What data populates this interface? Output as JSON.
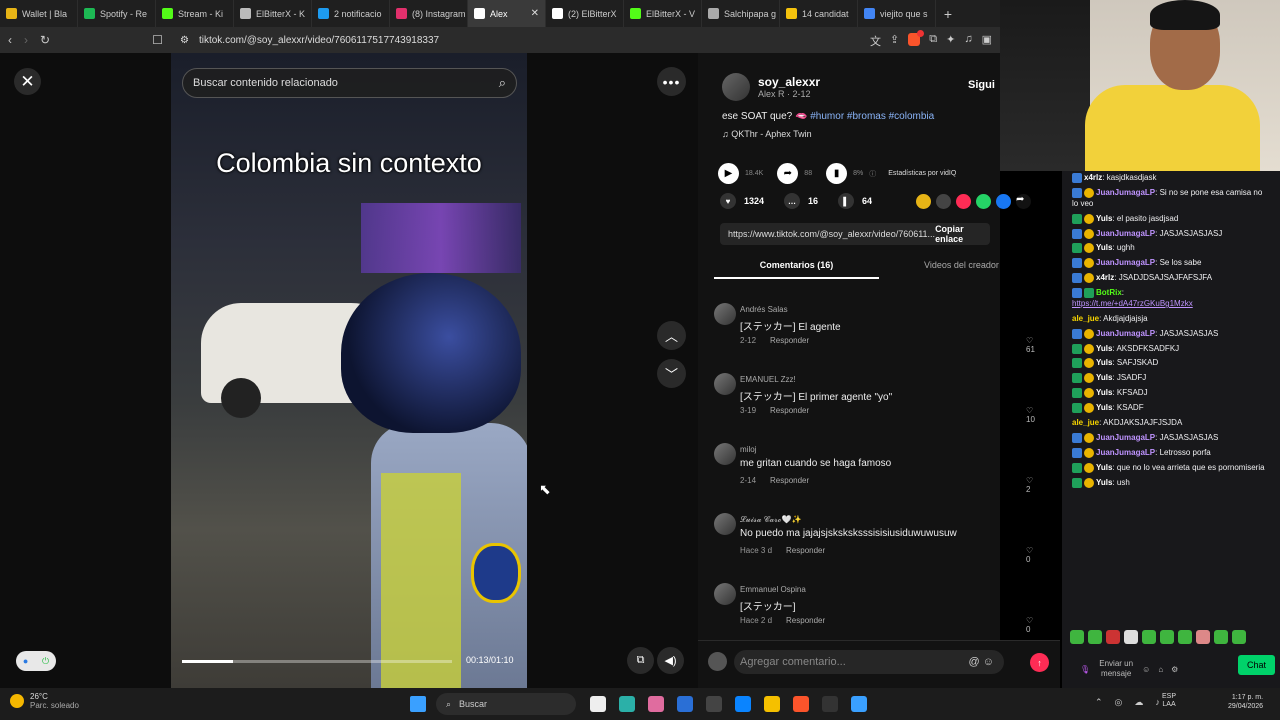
{
  "browser": {
    "tabs": [
      {
        "label": "Wallet | Bla",
        "color": "#e7b416",
        "active": false
      },
      {
        "label": "Spotify - Re",
        "color": "#1db954",
        "active": false
      },
      {
        "label": "Stream - Ki",
        "color": "#53fc18",
        "active": false
      },
      {
        "label": "ElBitterX - K",
        "color": "#bbbbbb",
        "active": false
      },
      {
        "label": "2 notificacio",
        "color": "#1d9bf0",
        "active": false
      },
      {
        "label": "(8) Instagram",
        "color": "#e1306c",
        "active": false
      },
      {
        "label": "Alex",
        "color": "#ffffff",
        "active": true
      },
      {
        "label": "(2) ElBitterX",
        "color": "#ffffff",
        "active": false
      },
      {
        "label": "ElBitterX - V",
        "color": "#53fc18",
        "active": false
      },
      {
        "label": "Salchipapa g",
        "color": "#aaaaaa",
        "active": false
      },
      {
        "label": "14 candidat",
        "color": "#f4c20d",
        "active": false
      },
      {
        "label": "viejito que s",
        "color": "#4285f4",
        "active": false
      }
    ],
    "url": "tiktok.com/@soy_alexxr/video/7606117517743918337"
  },
  "player": {
    "search_placeholder": "Buscar contenido relacionado",
    "caption": "Colombia sin contexto",
    "time": "00:13/01:10",
    "progress": 0.19
  },
  "post": {
    "username": "soy_alexxr",
    "subline": "Alex R · 2-12",
    "follow": "Sigui",
    "desc_text": "ese SOAT que? 🫦",
    "hashtags": "#humor #bromas #colombia",
    "music": "QKThr - Aphex Twin",
    "stats": {
      "plays": "18.4K",
      "shares": "88",
      "pct": "8%",
      "by": "Estadísticas por vidIQ"
    },
    "likes": "1324",
    "comments": "16",
    "saves": "64",
    "link": "https://www.tiktok.com/@soy_alexxr/video/760611...",
    "copy_label": "Copiar enlace",
    "tab_comments": "Comentarios (16)",
    "tab_videos": "Videos del creador",
    "comment_placeholder": "Agregar comentario..."
  },
  "comments": [
    {
      "name": "Andrés Salas",
      "text": "[ステッカー] El agente",
      "date": "2-12",
      "reply": "Responder",
      "likes": "61"
    },
    {
      "name": "EMANUEL Zzz!",
      "text": "[ステッカー] El primer agente \"yo\"",
      "date": "3-19",
      "reply": "Responder",
      "likes": "10"
    },
    {
      "name": "miloj",
      "text": "me gritan cuando se haga famoso",
      "date": "2-14",
      "reply": "Responder",
      "likes": "2"
    },
    {
      "name": "𝓛𝓾𝓲𝓼𝓪 𝓒𝓪𝓻𝓸🤍✨",
      "text": "No puedo ma jajajsjsksksksssisisiusiduwuwusuw",
      "date": "Hace 3 d",
      "reply": "Responder",
      "likes": "0"
    },
    {
      "name": "Emmanuel Ospina",
      "text": "[ステッカー]",
      "date": "Hace 2 d",
      "reply": "Responder",
      "likes": "0"
    }
  ],
  "chat": {
    "messages": [
      {
        "user": "x4rlz",
        "color": "#ffffff",
        "text": "kasjdkasdjask",
        "badges": "b"
      },
      {
        "user": "JuanJumagaLP",
        "color": "#bf94ff",
        "text": "Si no se pone esa camisa no lo veo",
        "badges": "bs"
      },
      {
        "user": "Yuls",
        "color": "#ffffff",
        "text": "el pasito jasdjsad",
        "badges": "ms"
      },
      {
        "user": "JuanJumagaLP",
        "color": "#bf94ff",
        "text": "JASJASJASJASJ",
        "badges": "bs"
      },
      {
        "user": "Yuls",
        "color": "#ffffff",
        "text": "ughh",
        "badges": "ms"
      },
      {
        "user": "JuanJumagaLP",
        "color": "#bf94ff",
        "text": "Se los sabe",
        "badges": "bs"
      },
      {
        "user": "x4rlz",
        "color": "#ffffff",
        "text": "JSADJDSAJSAJFAFSJFA",
        "badges": "bs"
      },
      {
        "user": "BotRix",
        "color": "#53fc18",
        "text": "",
        "link": "https://t.me/+dA47rzGKuBg1Mzkx",
        "badges": "bm"
      },
      {
        "user": "ale_jue",
        "color": "#f5d300",
        "text": "Akdjajdjajsja",
        "badges": ""
      },
      {
        "user": "JuanJumagaLP",
        "color": "#bf94ff",
        "text": "JASJASJASJAS",
        "badges": "bs"
      },
      {
        "user": "Yuls",
        "color": "#ffffff",
        "text": "AKSDFKSADFKJ",
        "badges": "ms"
      },
      {
        "user": "Yuls",
        "color": "#ffffff",
        "text": "SAFJSKAD",
        "badges": "ms"
      },
      {
        "user": "Yuls",
        "color": "#ffffff",
        "text": "JSADFJ",
        "badges": "ms"
      },
      {
        "user": "Yuls",
        "color": "#ffffff",
        "text": "KFSADJ",
        "badges": "ms"
      },
      {
        "user": "Yuls",
        "color": "#ffffff",
        "text": "KSADF",
        "badges": "ms"
      },
      {
        "user": "ale_jue",
        "color": "#f5d300",
        "text": "AKDJAKSJAJFJSJDA",
        "badges": ""
      },
      {
        "user": "JuanJumagaLP",
        "color": "#bf94ff",
        "text": "JASJASJASJAS",
        "badges": "bs"
      },
      {
        "user": "JuanJumagaLP",
        "color": "#bf94ff",
        "text": "Letrosso porfa",
        "badges": "bs"
      },
      {
        "user": "Yuls",
        "color": "#ffffff",
        "text": "que no lo vea arrieta que es pornomiseria",
        "badges": "ms"
      },
      {
        "user": "Yuls",
        "color": "#ffffff",
        "text": "ush",
        "badges": "ms"
      }
    ],
    "send_placeholder": "Enviar un mensaje",
    "chat_button": "Chat"
  },
  "taskbar": {
    "temp": "26°C",
    "weather": "Parc. soleado",
    "search": "Buscar",
    "lang1": "ESP",
    "lang2": "LAA",
    "time": "1:17 p. m.",
    "date": "29/04/2026"
  }
}
